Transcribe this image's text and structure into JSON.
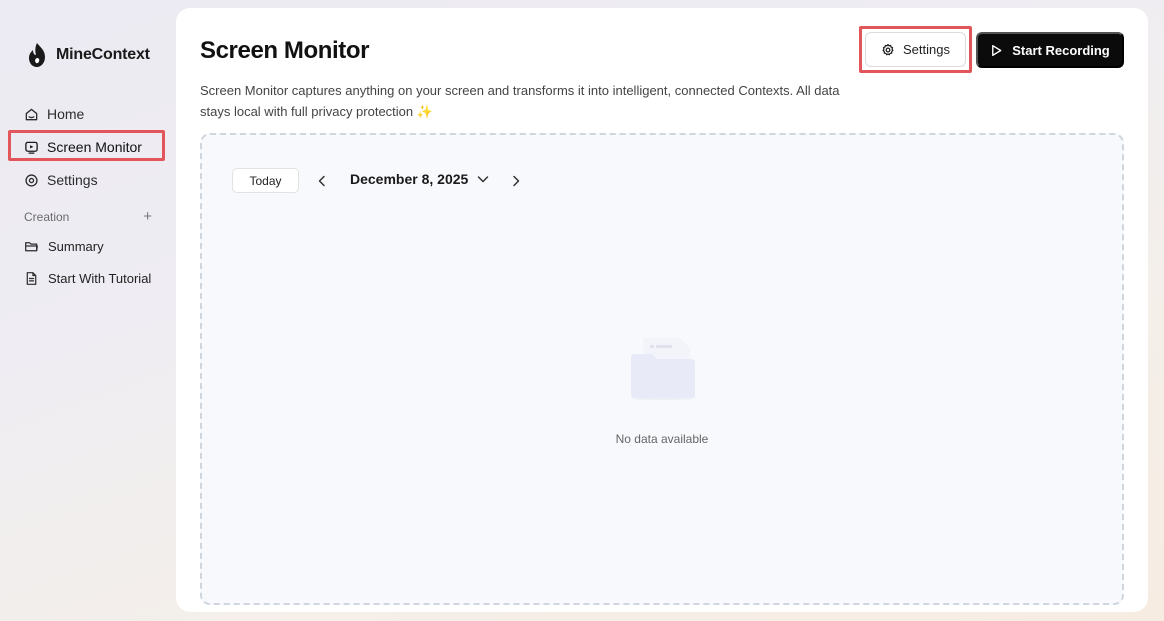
{
  "brand": {
    "name": "MineContext",
    "logo_icon": "flame-cat-logo-icon"
  },
  "sidebar": {
    "nav": [
      {
        "label": "Home",
        "icon": "home-icon",
        "active": false
      },
      {
        "label": "Screen Monitor",
        "icon": "monitor-icon",
        "active": true
      },
      {
        "label": "Settings",
        "icon": "gear-icon",
        "active": false
      }
    ],
    "section": {
      "label": "Creation",
      "add_icon": "plus-icon"
    },
    "docs": [
      {
        "label": "Summary",
        "icon": "folder-icon"
      },
      {
        "label": "Start With Tutorial",
        "icon": "document-icon"
      }
    ]
  },
  "main": {
    "title": "Screen Monitor",
    "description": "Screen Monitor captures anything on your screen and transforms it into intelligent, connected Contexts. All data stays local with full privacy protection ✨",
    "settings_button": "Settings",
    "record_button": "Start Recording",
    "timeline": {
      "today_button": "Today",
      "date": "December 8, 2025",
      "empty_text": "No data available"
    }
  },
  "colors": {
    "highlight": "#e2555a",
    "primary_button": "#0b0b0b",
    "timeline_bg": "#f8f9fc"
  }
}
